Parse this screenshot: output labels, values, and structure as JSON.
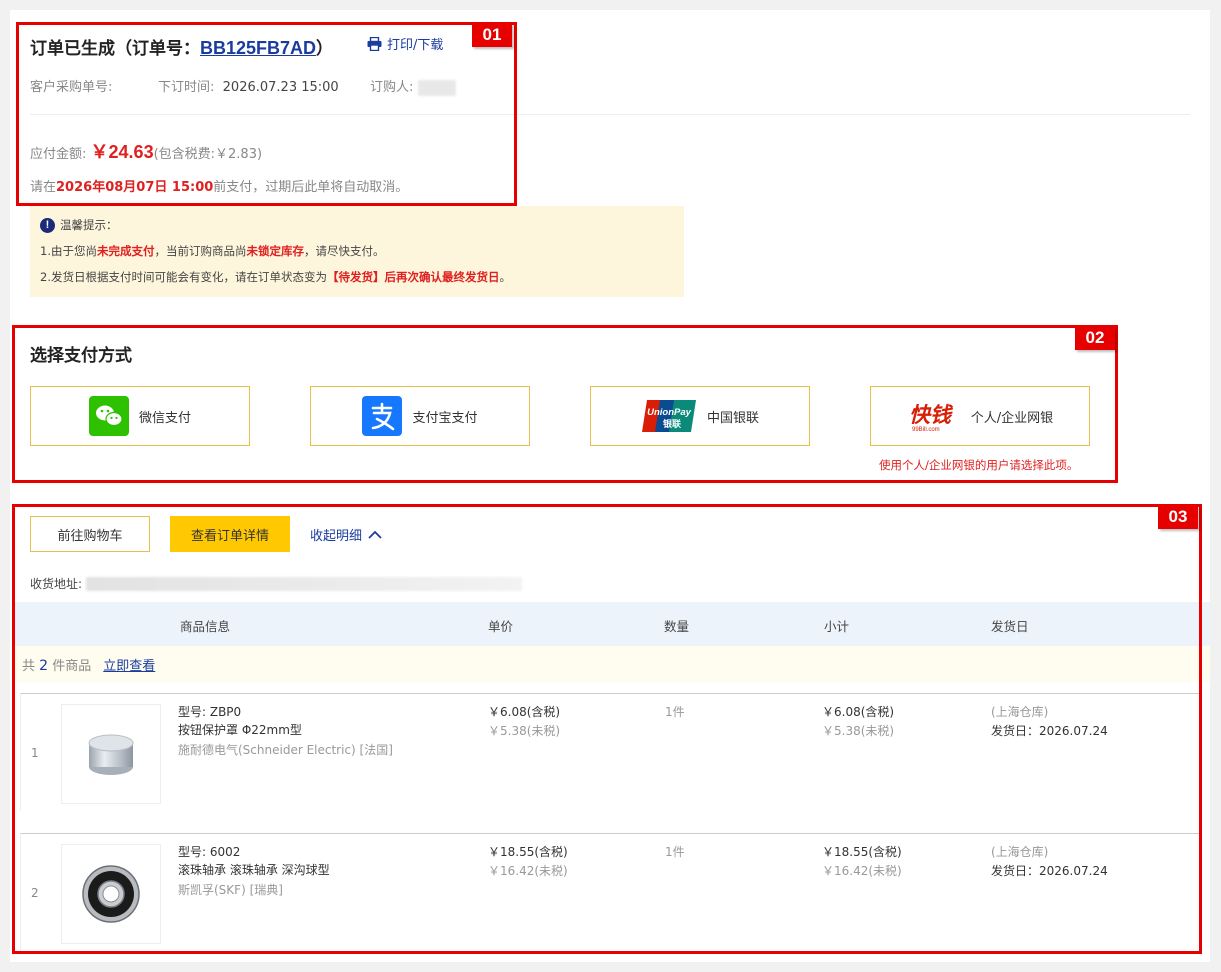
{
  "order": {
    "title_prefix": "订单已生成（订单号：",
    "order_no": "BB125FB7AD",
    "title_suffix": "）",
    "print_label": "打印/下载",
    "customer_po_label": "客户采购单号:",
    "order_time_label": "下订时间:",
    "order_time": "2026.07.23 15:00",
    "buyer_label": "订购人:",
    "amount_label": "应付金额:",
    "amount": "￥24.63",
    "tax_note": "(包含税费:￥2.83)",
    "deadline_prefix": "请在",
    "deadline": "2026年08月07日 15:00",
    "deadline_suffix": "前支付，过期后此单将自动取消。"
  },
  "tips": {
    "title": "温馨提示：",
    "line1_a": "1.由于您尚",
    "line1_b": "未完成支付",
    "line1_c": "，当前订购商品尚",
    "line1_d": "未锁定库存",
    "line1_e": "，请尽快支付。",
    "line2_a": "2.发货日根据支付时间可能会有变化，请在订单状态变为",
    "line2_b": "【待发货】后再次确认最终发货日",
    "line2_c": "。"
  },
  "payment": {
    "title": "选择支付方式",
    "methods": [
      {
        "label": "微信支付",
        "icon": "wechat-pay-icon"
      },
      {
        "label": "支付宝支付",
        "icon": "alipay-icon"
      },
      {
        "label": "中国银联",
        "icon": "unionpay-icon"
      },
      {
        "label": "个人/企业网银",
        "icon": "99bill-icon"
      }
    ],
    "unionpay_logo_top": "UnionPay",
    "unionpay_logo_bottom": "银联",
    "bill_logo": "快钱",
    "bill_logo_sub": "99Bill.com",
    "note": "使用个人/企业网银的用户请选择此项。"
  },
  "actions": {
    "cart_label": "前往购物车",
    "detail_label": "查看订单详情",
    "collapse_label": "收起明细",
    "address_label": "收货地址:"
  },
  "table": {
    "headers": [
      "商品信息",
      "单价",
      "数量",
      "小计",
      "发货日"
    ],
    "count_prefix": "共",
    "count": "2",
    "count_suffix": "件商品",
    "view_now": "立即查看"
  },
  "items": [
    {
      "index": "1",
      "model": "型号: ZBP0",
      "name": "按钮保护罩 Φ22mm型",
      "brand": "施耐德电气(Schneider Electric) [法国]",
      "price_tax": "￥6.08(含税)",
      "price_notax": "￥5.38(未税)",
      "qty": "1件",
      "sub_tax": "￥6.08(含税)",
      "sub_notax": "￥5.38(未税)",
      "warehouse": "(上海仓库)",
      "ship_date": "发货日：2026.07.24"
    },
    {
      "index": "2",
      "model": "型号: 6002",
      "name": "滚珠轴承 滚珠轴承 深沟球型",
      "brand": "斯凯孚(SKF) [瑞典]",
      "price_tax": "￥18.55(含税)",
      "price_notax": "￥16.42(未税)",
      "qty": "1件",
      "sub_tax": "￥18.55(含税)",
      "sub_notax": "￥16.42(未税)",
      "warehouse": "(上海仓库)",
      "ship_date": "发货日：2026.07.24"
    }
  ],
  "annotations": [
    "01",
    "02",
    "03"
  ],
  "colors": {
    "annotation_red": "#e60000",
    "link_blue": "#1a3ca0",
    "price_red": "#e02020",
    "button_yellow": "#ffc800",
    "tips_bg": "#fdf5dc",
    "table_head_bg": "#edf3fb"
  }
}
